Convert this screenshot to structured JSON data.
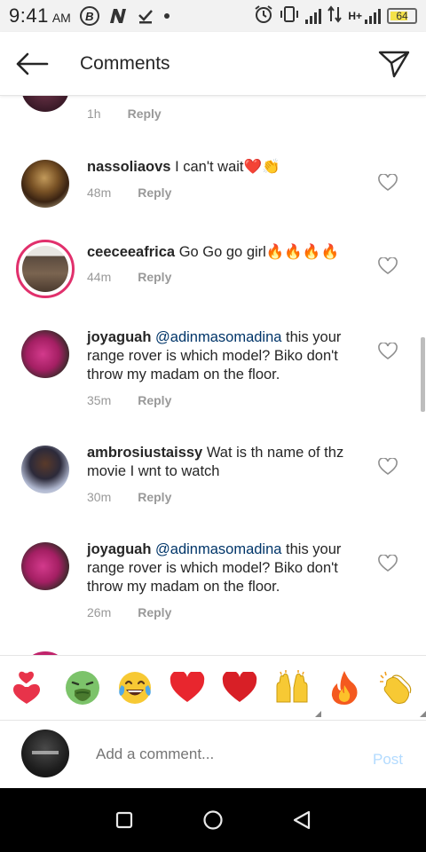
{
  "status_bar": {
    "time": "9:41",
    "ampm": "AM",
    "battery_level": "64",
    "network": "H+"
  },
  "header": {
    "title": "Comments"
  },
  "comments": [
    {
      "meta_time": "1h",
      "reply_label": "Reply"
    },
    {
      "username": "nassoliaovs",
      "text": "I can't wait",
      "emoji": "❤️👏",
      "meta_time": "48m",
      "reply_label": "Reply"
    },
    {
      "username": "ceeceeafrica",
      "text": "Go Go go girl",
      "emoji": "🔥🔥🔥🔥",
      "meta_time": "44m",
      "reply_label": "Reply"
    },
    {
      "username": "joyaguah",
      "mention": "@adinmasomadina",
      "text": "this your range rover is which model? Biko don't throw my madam on the floor.",
      "meta_time": "35m",
      "reply_label": "Reply"
    },
    {
      "username": "ambrosiustaissy",
      "text": "Wat is th name of thz movie I wnt to watch",
      "meta_time": "30m",
      "reply_label": "Reply"
    },
    {
      "username": "joyaguah",
      "mention": "@adinmasomadina",
      "text": "this your range rover is which model? Biko don't throw my madam on the floor.",
      "meta_time": "26m",
      "reply_label": "Reply"
    }
  ],
  "emoji_bar": [
    "💕",
    "🤮",
    "😂",
    "❤",
    "❤️",
    "🙌",
    "🔥",
    "👏"
  ],
  "composer": {
    "placeholder": "Add a comment...",
    "post_label": "Post"
  },
  "colors": {
    "accent_ring": "#e1306c",
    "mention": "#003569",
    "post_disabled": "#b3dbff",
    "meta": "#999999"
  }
}
